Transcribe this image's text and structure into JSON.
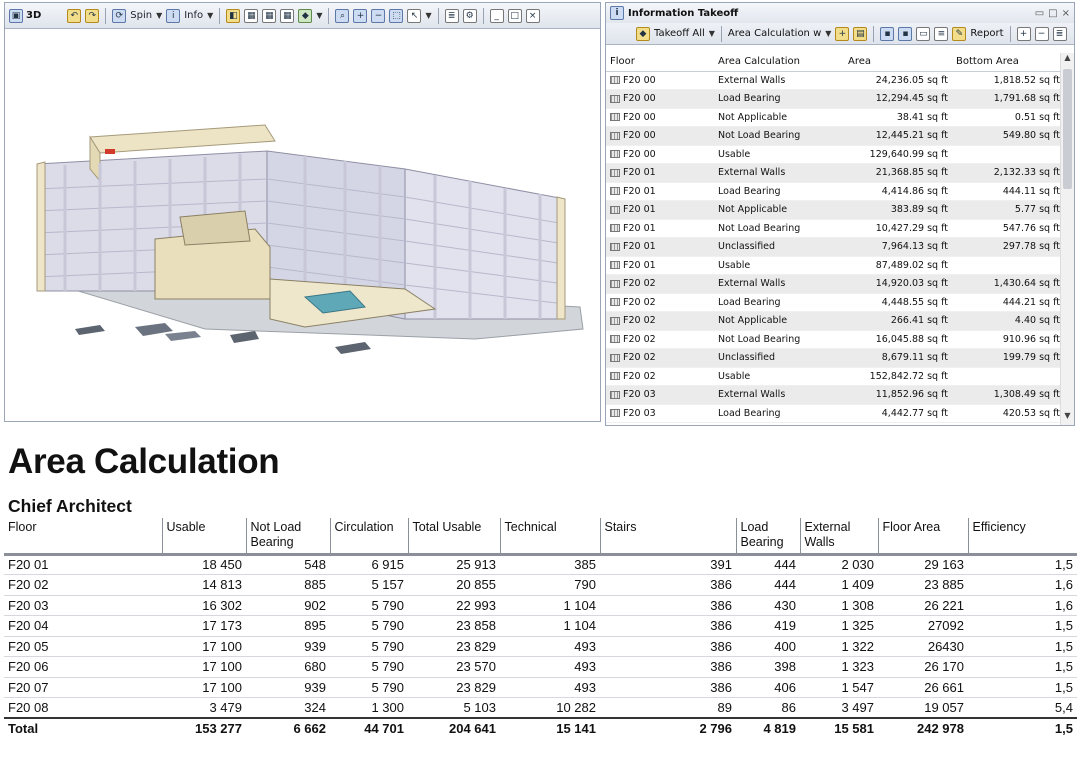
{
  "viewer3d": {
    "title": "3D",
    "toolbar": {
      "spin_label": "Spin",
      "info_label": "Info"
    }
  },
  "takeoff": {
    "title": "Information Takeoff",
    "toolbar": {
      "takeoff_all_label": "Takeoff All",
      "calc_label": "Area Calculation w",
      "report_label": "Report"
    },
    "columns": [
      "Floor",
      "Area Calculation",
      "Area",
      "Bottom Area"
    ],
    "rows": [
      [
        "F20 00",
        "External Walls",
        "24,236.05 sq ft",
        "1,818.52 sq ft"
      ],
      [
        "F20 00",
        "Load Bearing",
        "12,294.45 sq ft",
        "1,791.68 sq ft"
      ],
      [
        "F20 00",
        "Not Applicable",
        "38.41 sq ft",
        "0.51 sq ft"
      ],
      [
        "F20 00",
        "Not Load Bearing",
        "12,445.21 sq ft",
        "549.80 sq ft"
      ],
      [
        "F20 00",
        "Usable",
        "129,640.99 sq ft",
        ""
      ],
      [
        "F20 01",
        "External Walls",
        "21,368.85 sq ft",
        "2,132.33 sq ft"
      ],
      [
        "F20 01",
        "Load Bearing",
        "4,414.86 sq ft",
        "444.11 sq ft"
      ],
      [
        "F20 01",
        "Not Applicable",
        "383.89 sq ft",
        "5.77 sq ft"
      ],
      [
        "F20 01",
        "Not Load Bearing",
        "10,427.29 sq ft",
        "547.76 sq ft"
      ],
      [
        "F20 01",
        "Unclassified",
        "7,964.13 sq ft",
        "297.78 sq ft"
      ],
      [
        "F20 01",
        "Usable",
        "87,489.02 sq ft",
        ""
      ],
      [
        "F20 02",
        "External Walls",
        "14,920.03 sq ft",
        "1,430.64 sq ft"
      ],
      [
        "F20 02",
        "Load Bearing",
        "4,448.55 sq ft",
        "444.21 sq ft"
      ],
      [
        "F20 02",
        "Not Applicable",
        "266.41 sq ft",
        "4.40 sq ft"
      ],
      [
        "F20 02",
        "Not Load Bearing",
        "16,045.88 sq ft",
        "910.96 sq ft"
      ],
      [
        "F20 02",
        "Unclassified",
        "8,679.11 sq ft",
        "199.79 sq ft"
      ],
      [
        "F20 02",
        "Usable",
        "152,842.72 sq ft",
        ""
      ],
      [
        "F20 03",
        "External Walls",
        "11,852.96 sq ft",
        "1,308.49 sq ft"
      ],
      [
        "F20 03",
        "Load Bearing",
        "4,442.77 sq ft",
        "420.53 sq ft"
      ]
    ]
  },
  "report": {
    "title": "Area Calculation",
    "subtitle": "Chief Architect",
    "columns": [
      "Floor",
      "Usable",
      "Not Load Bearing",
      "Circulation",
      "Total Usable",
      "Technical",
      "Stairs",
      "Load Bearing",
      "External Walls",
      "Floor Area",
      "Efficiency"
    ],
    "rows": [
      [
        "F20 01",
        "18 450",
        "548",
        "6 915",
        "25 913",
        "385",
        "391",
        "444",
        "2 030",
        "29 163",
        "1,5"
      ],
      [
        "F20 02",
        "14 813",
        "885",
        "5 157",
        "20 855",
        "790",
        "386",
        "444",
        "1 409",
        "23 885",
        "1,6"
      ],
      [
        "F20 03",
        "16 302",
        "902",
        "5 790",
        "22 993",
        "1 104",
        "386",
        "430",
        "1 308",
        "26 221",
        "1,6"
      ],
      [
        "F20 04",
        "17 173",
        "895",
        "5 790",
        "23 858",
        "1 104",
        "386",
        "419",
        "1 325",
        "27092",
        "1,5"
      ],
      [
        "F20 05",
        "17 100",
        "939",
        "5 790",
        "23 829",
        "493",
        "386",
        "400",
        "1 322",
        "26430",
        "1,5"
      ],
      [
        "F20 06",
        "17 100",
        "680",
        "5 790",
        "23 570",
        "493",
        "386",
        "398",
        "1 323",
        "26 170",
        "1,5"
      ],
      [
        "F20 07",
        "17 100",
        "939",
        "5 790",
        "23 829",
        "493",
        "386",
        "406",
        "1 547",
        "26 661",
        "1,5"
      ],
      [
        "F20 08",
        "3 479",
        "324",
        "1 300",
        "5 103",
        "10 282",
        "89",
        "86",
        "3 497",
        "19 057",
        "5,4"
      ]
    ],
    "total": [
      "Total",
      "153 277",
      "6 662",
      "44 701",
      "204 641",
      "15 141",
      "2 796",
      "4 819",
      "15 581",
      "242 978",
      "1,5"
    ]
  }
}
